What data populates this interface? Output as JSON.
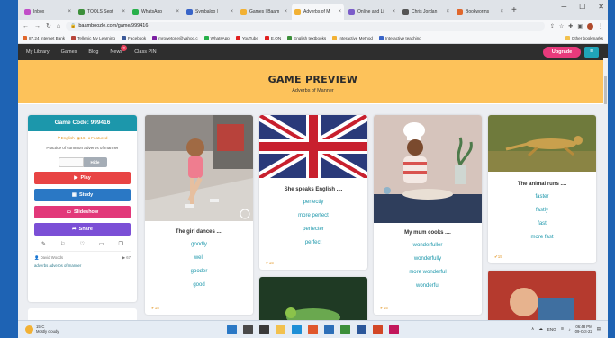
{
  "browser": {
    "tabs": [
      {
        "label": "Inbox",
        "color": "#c14dc7",
        "active": false
      },
      {
        "label": "TOOLS Sept",
        "color": "#3c8f3a",
        "active": false
      },
      {
        "label": "WhatsApp",
        "color": "#27b04a",
        "active": false
      },
      {
        "label": "Symbaloo |",
        "color": "#3864c8",
        "active": false
      },
      {
        "label": "Games | Baam",
        "color": "#f2b134",
        "active": false
      },
      {
        "label": "Adverbs of M",
        "color": "#f2b134",
        "active": true
      },
      {
        "label": "Online and Li",
        "color": "#7a5cc9",
        "active": false
      },
      {
        "label": "Chris Jordan",
        "color": "#555555",
        "active": false
      },
      {
        "label": "Bookworms",
        "color": "#e0672c",
        "active": false
      }
    ],
    "new_tab": "+",
    "url": "baamboozle.com/game/999416",
    "bookmarks": [
      {
        "label": "87.24 Internet Bank",
        "color": "#e0672c"
      },
      {
        "label": "Tellenic My Learning",
        "color": "#b8463b"
      },
      {
        "label": "Facebook",
        "color": "#3b5998"
      },
      {
        "label": "mrowetone@yahoo.c",
        "color": "#7b1fa2"
      },
      {
        "label": "WhatsApp",
        "color": "#27b04a"
      },
      {
        "label": "YouTube",
        "color": "#e02020"
      },
      {
        "label": "E.ON",
        "color": "#e02020"
      },
      {
        "label": "English textbooks",
        "color": "#3c8f3a"
      },
      {
        "label": "Interactive Method",
        "color": "#f2b134"
      },
      {
        "label": "Interactive teaching",
        "color": "#3864c8"
      }
    ],
    "other_bookmarks": "Other bookmarks"
  },
  "site": {
    "nav": [
      "My Library",
      "Games",
      "Blog",
      "News",
      "Class PIN"
    ],
    "news_badge": "2",
    "upgrade": "Upgrade",
    "menu_icon": "hamburger-icon"
  },
  "hero": {
    "title": "Game Preview",
    "subtitle": "Adverbs of Manner"
  },
  "game": {
    "code": "Game Code: 999416",
    "language": "English",
    "questions": "16",
    "status": "Featured",
    "description": "Practice of common adverbs of manner",
    "hide": "Hide",
    "buttons": [
      {
        "label": "Play",
        "icon": "play-icon",
        "color": "#e84444"
      },
      {
        "label": "Study",
        "icon": "study-icon",
        "color": "#2a78c5"
      },
      {
        "label": "Slideshow",
        "icon": "slideshow-icon",
        "color": "#e2387a"
      },
      {
        "label": "Share",
        "icon": "share-icon",
        "color": "#7b4fd6"
      }
    ],
    "author": "David Woods",
    "plays": "67",
    "tags": "adverbs adverbs of manner"
  },
  "cards": [
    {
      "caption": "The girl dances ....",
      "options": [
        "goodly",
        "well",
        "gooder",
        "good"
      ],
      "score": "15"
    },
    {
      "caption": "She speaks English ....",
      "options": [
        "perfectly",
        "more perfect",
        "perfecter",
        "perfect"
      ],
      "score": "15"
    },
    {
      "caption": "My mum cooks ....",
      "options": [
        "wonderfuller",
        "wonderfully",
        "more wonderful",
        "wonderful"
      ],
      "score": "15"
    },
    {
      "caption": "The animal runs ....",
      "options": [
        "faster",
        "fastly",
        "fast",
        "more fast"
      ],
      "score": "15"
    }
  ],
  "taskbar": {
    "temperature": "15°C",
    "weather": "Mostly cloudy",
    "time": "06:48 PM",
    "date": "09-Oct-22",
    "lang": "ENG"
  },
  "colors": {
    "accent": "#1c97ab",
    "hero": "#fdc25a",
    "nav": "#2e2e2e",
    "upgrade": "#e83a7c"
  }
}
